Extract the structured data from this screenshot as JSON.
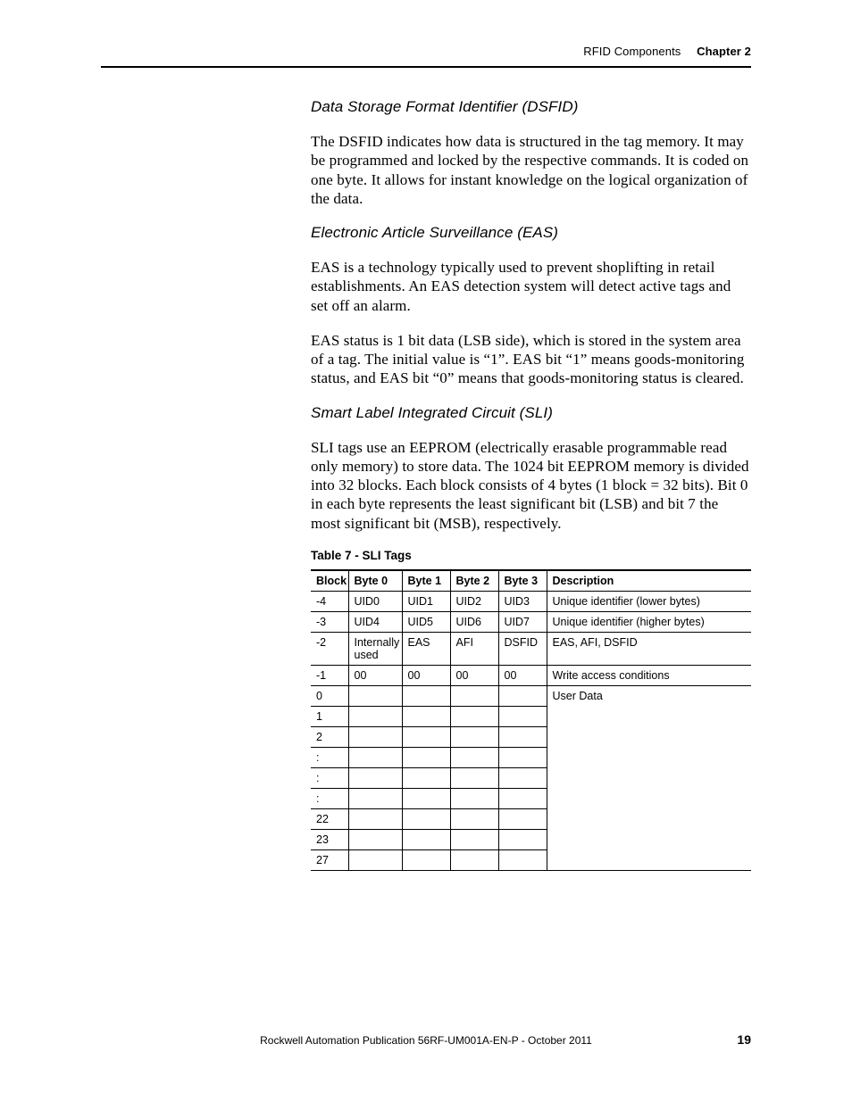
{
  "header": {
    "section": "RFID Components",
    "chapter": "Chapter 2"
  },
  "sec1": {
    "title": "Data Storage Format Identifier (DSFID)",
    "p1": "The DSFID indicates how data is structured in the tag memory. It may be programmed and locked by the respective commands. It is coded on one byte. It allows for instant knowledge on the logical organization of the data."
  },
  "sec2": {
    "title": "Electronic Article Surveillance (EAS)",
    "p1": "EAS is a technology typically used to prevent shoplifting in retail establishments. An EAS detection system will detect active tags and set off an alarm.",
    "p2": "EAS status is 1 bit data (LSB side), which is stored in the system area of a tag. The initial value is “1”. EAS bit “1” means goods-monitoring status, and EAS bit “0” means that goods-monitoring status is cleared."
  },
  "sec3": {
    "title": "Smart Label Integrated Circuit (SLI)",
    "p1": "SLI tags use an EEPROM (electrically erasable programmable read only memory) to store data. The 1024 bit EEPROM memory is divided into 32 blocks. Each block consists of 4 bytes (1 block = 32 bits). Bit 0 in each byte represents the least significant bit (LSB) and bit 7 the most significant bit (MSB), respectively."
  },
  "table": {
    "caption": "Table 7 - SLI Tags",
    "head": {
      "c0": "Block",
      "c1": "Byte 0",
      "c2": "Byte 1",
      "c3": "Byte 2",
      "c4": "Byte 3",
      "c5": "Description"
    },
    "rows": [
      {
        "c0": "-4",
        "c1": "UID0",
        "c2": "UID1",
        "c3": "UID2",
        "c4": "UID3",
        "c5": "Unique identifier (lower bytes)"
      },
      {
        "c0": "-3",
        "c1": "UID4",
        "c2": "UID5",
        "c3": "UID6",
        "c4": "UID7",
        "c5": "Unique identifier (higher bytes)"
      },
      {
        "c0": "-2",
        "c1": "Internally used",
        "c2": "EAS",
        "c3": "AFI",
        "c4": "DSFID",
        "c5": "EAS, AFI, DSFID"
      },
      {
        "c0": "-1",
        "c1": "00",
        "c2": "00",
        "c3": "00",
        "c4": "00",
        "c5": "Write access conditions"
      },
      {
        "c0": "0",
        "c1": "",
        "c2": "",
        "c3": "",
        "c4": "",
        "c5": "User Data"
      },
      {
        "c0": "1",
        "c1": "",
        "c2": "",
        "c3": "",
        "c4": ""
      },
      {
        "c0": "2",
        "c1": "",
        "c2": "",
        "c3": "",
        "c4": ""
      },
      {
        "c0": ":",
        "c1": "",
        "c2": "",
        "c3": "",
        "c4": ""
      },
      {
        "c0": ":",
        "c1": "",
        "c2": "",
        "c3": "",
        "c4": ""
      },
      {
        "c0": ":",
        "c1": "",
        "c2": "",
        "c3": "",
        "c4": ""
      },
      {
        "c0": "22",
        "c1": "",
        "c2": "",
        "c3": "",
        "c4": ""
      },
      {
        "c0": "23",
        "c1": "",
        "c2": "",
        "c3": "",
        "c4": ""
      },
      {
        "c0": "27",
        "c1": "",
        "c2": "",
        "c3": "",
        "c4": ""
      }
    ]
  },
  "footer": {
    "publication": "Rockwell Automation Publication 56RF-UM001A-EN-P - October 2011",
    "page": "19"
  }
}
